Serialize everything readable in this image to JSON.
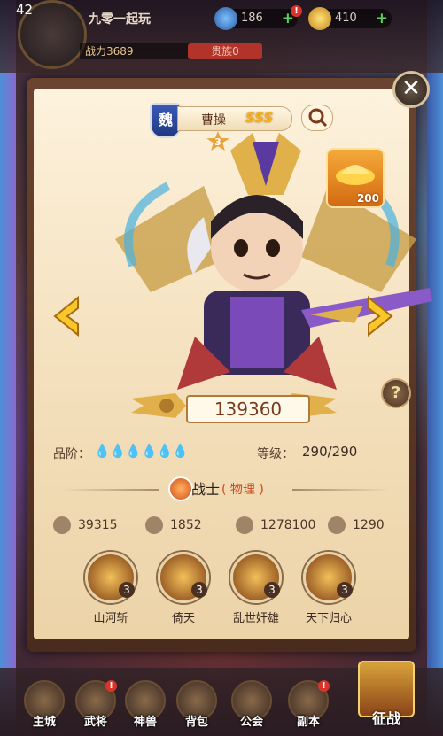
{
  "player": {
    "level": "42",
    "name": "九零一起玩",
    "power": "战力3689",
    "nobility": "贵族0"
  },
  "resources": {
    "gems": "186",
    "gold": "410"
  },
  "hero": {
    "kingdom": "魏",
    "name": "曹操",
    "grade": "SSS",
    "stars": "3",
    "combat_power": "139360",
    "ingot_count": "200"
  },
  "stats": {
    "grade_label": "品阶：",
    "grade_drops": "💧💧💧💧💧💧",
    "level_label": "等级：",
    "level_value": "290/290",
    "class_name": "战士",
    "class_type": "( 物理 )",
    "attack": "39315",
    "defense": "1852",
    "hp": "1278100",
    "speed": "1290"
  },
  "skills": [
    {
      "name": "山河斩",
      "level": "3"
    },
    {
      "name": "倚天",
      "level": "3"
    },
    {
      "name": "乱世奸雄",
      "level": "3"
    },
    {
      "name": "天下归心",
      "level": "3"
    }
  ],
  "nav": [
    {
      "label": "主城"
    },
    {
      "label": "武将"
    },
    {
      "label": "神兽"
    },
    {
      "label": "背包"
    },
    {
      "label": "公会"
    },
    {
      "label": "副本"
    },
    {
      "label": "征战"
    }
  ],
  "icons": {
    "close": "close-icon",
    "search": "magnify-icon",
    "prev": "arrow-left-icon",
    "next": "arrow-right-icon",
    "help": "question-icon",
    "help_glyph": "?",
    "close_glyph": "✕"
  },
  "colors": {
    "accent_gold": "#f2b21a",
    "class_red": "#d2451a",
    "badge_red": "#d8352a"
  }
}
